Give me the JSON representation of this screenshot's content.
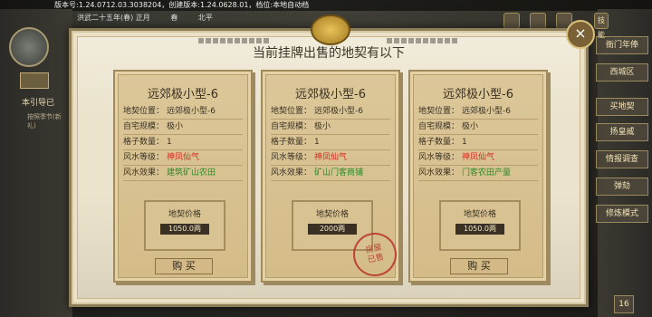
{
  "version_text": "版本号:1.24.0712.03.3038204，创建版本:1.24.0628.01，档位:本地自动档",
  "date_strip": [
    "洪武二十五年(春) 正月",
    "春",
    "北平"
  ],
  "left_panel": {
    "chip": "",
    "menu_text": "本引导已",
    "sub_text": "按照季节(新礼)"
  },
  "right_panel": {
    "skill_label": "技能",
    "menus": [
      "衙门年俸",
      "西城区",
      "买地契",
      "扬皇威",
      "情报调查",
      "弹劾",
      "修炼模式"
    ],
    "bottom_label": "16"
  },
  "dialog": {
    "title": "当前挂牌出售的地契有以下",
    "close_icon": "×"
  },
  "field_labels": {
    "location": "地契位置：",
    "scale": "自宅规模：",
    "grid": "格子数量：",
    "fengshui_level": "风水等级：",
    "fengshui_effect": "风水效果："
  },
  "price_label": "地契价格",
  "buy_label": "购 买",
  "sold_stamp": [
    "房屋",
    "已售"
  ],
  "cards": [
    {
      "title": "远郊极小型-6",
      "location": "远郊极小型-6",
      "scale": "极小",
      "grid": "1",
      "fengshui_level": "神凤仙气",
      "fengshui_effect": "建筑矿山农田",
      "price": "1050.0两",
      "sold": false
    },
    {
      "title": "远郊极小型-6",
      "location": "远郊极小型-6",
      "scale": "极小",
      "grid": "1",
      "fengshui_level": "神凤仙气",
      "fengshui_effect": "矿山门客商铺",
      "price": "2000两",
      "sold": true
    },
    {
      "title": "远郊极小型-6",
      "location": "远郊极小型-6",
      "scale": "极小",
      "grid": "1",
      "fengshui_level": "神凤仙气",
      "fengshui_effect": "门客农田产量",
      "price": "1050.0两",
      "sold": false
    }
  ],
  "colors": {
    "fengshui_level": "#d62a1f",
    "fengshui_effect": "#2c8a28",
    "stamp": "#b83129"
  }
}
